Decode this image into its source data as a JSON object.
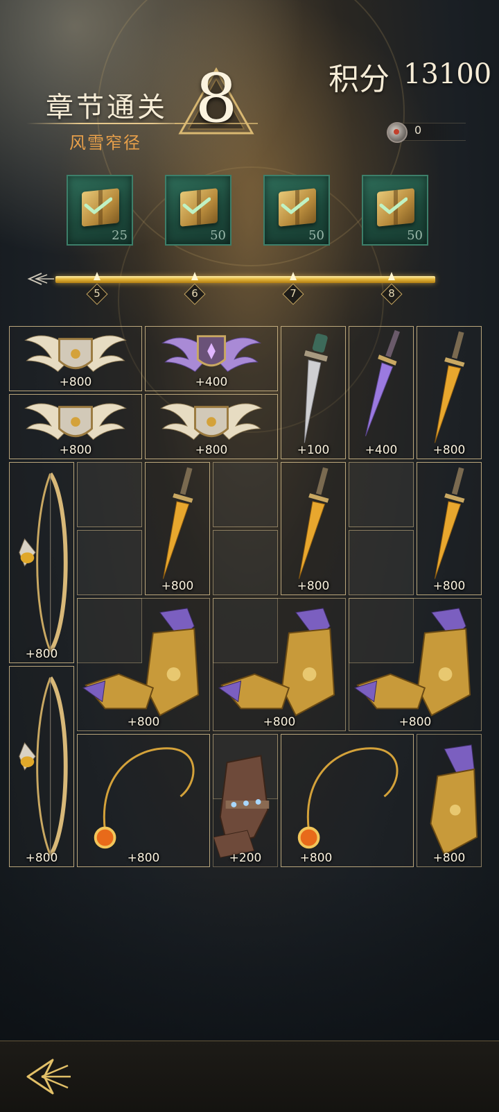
{
  "header": {
    "chapter_title": "章节通关",
    "chapter_name": "风雪窄径",
    "chapter_number": "8",
    "score_label": "积分",
    "score_value": "13100",
    "currency_value": "0"
  },
  "milestones": [
    {
      "chest_value": "25",
      "level": "5",
      "claimed": true
    },
    {
      "chest_value": "50",
      "level": "6",
      "claimed": true
    },
    {
      "chest_value": "50",
      "level": "7",
      "claimed": true
    },
    {
      "chest_value": "50",
      "level": "8",
      "claimed": true
    }
  ],
  "items": [
    {
      "name": "winged-shield-gold-icon",
      "value": "+800"
    },
    {
      "name": "winged-shield-purple-icon",
      "value": "+400"
    },
    {
      "name": "dagger-silver-icon",
      "value": "+100"
    },
    {
      "name": "dagger-purple-icon",
      "value": "+400"
    },
    {
      "name": "dagger-gold-icon",
      "value": "+800"
    },
    {
      "name": "winged-shield-gold-icon",
      "value": "+800"
    },
    {
      "name": "winged-shield-gold-icon",
      "value": "+800"
    },
    {
      "name": "bow-gold-icon",
      "value": "+800"
    },
    {
      "name": "dagger-gold-icon",
      "value": "+800"
    },
    {
      "name": "dagger-gold-icon",
      "value": "+800"
    },
    {
      "name": "dagger-gold-icon",
      "value": "+800"
    },
    {
      "name": "gauntlet-gold-icon",
      "value": "+800"
    },
    {
      "name": "gauntlet-gold-icon",
      "value": "+800"
    },
    {
      "name": "gauntlet-gold-icon",
      "value": "+800"
    },
    {
      "name": "bow-gold-icon",
      "value": "+800"
    },
    {
      "name": "amulet-sun-icon",
      "value": "+800"
    },
    {
      "name": "glove-leather-icon",
      "value": "+200"
    },
    {
      "name": "amulet-sun-icon",
      "value": "+800"
    },
    {
      "name": "gauntlet-gold-icon",
      "value": "+800"
    }
  ],
  "colors": {
    "gold": "#e4b53a",
    "chest_green": "#2f6e5a",
    "highlight_orange": "#e8a04a"
  }
}
